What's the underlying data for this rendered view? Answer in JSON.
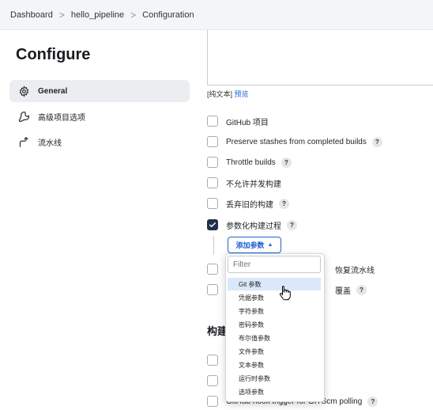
{
  "breadcrumb": {
    "items": [
      "Dashboard",
      "hello_pipeline",
      "Configuration"
    ],
    "separator": ">"
  },
  "sidebar": {
    "title": "Configure",
    "items": [
      {
        "label": "General",
        "icon": "gear-icon",
        "active": true
      },
      {
        "label": "高级项目选项",
        "icon": "wrench-icon",
        "active": false
      },
      {
        "label": "流水线",
        "icon": "pipeline-icon",
        "active": false
      }
    ]
  },
  "main": {
    "plain_text": "[纯文本]",
    "preview": "预览",
    "options": [
      {
        "label": "GitHub 项目",
        "checked": false,
        "help": false
      },
      {
        "label": "Preserve stashes from completed builds",
        "checked": false,
        "help": true
      },
      {
        "label": "Throttle builds",
        "checked": false,
        "help": true
      },
      {
        "label": "不允许并发构建",
        "checked": false,
        "help": false
      },
      {
        "label": "丢弃旧的构建",
        "checked": false,
        "help": true
      },
      {
        "label": "参数化构建过程",
        "checked": true,
        "help": true
      }
    ],
    "add_param_button": "添加参数",
    "partial_option_1": "恢复流水线",
    "partial_option_2": "覆盖",
    "section_heading_partial": "构建",
    "bottom_option": "GitHub hook trigger for GITScm polling",
    "help_label": "?"
  },
  "dropdown": {
    "filter_placeholder": "Filter",
    "items": [
      "Git 参数",
      "凭据参数",
      "字符参数",
      "密码参数",
      "布尔值参数",
      "文件参数",
      "文本参数",
      "运行时参数",
      "选项参数"
    ],
    "highlighted_index": 0
  },
  "colors": {
    "accent": "#1e63d6",
    "checked": "#20304d",
    "active_nav": "#ebedf0",
    "highlight": "#dbe7fb"
  }
}
